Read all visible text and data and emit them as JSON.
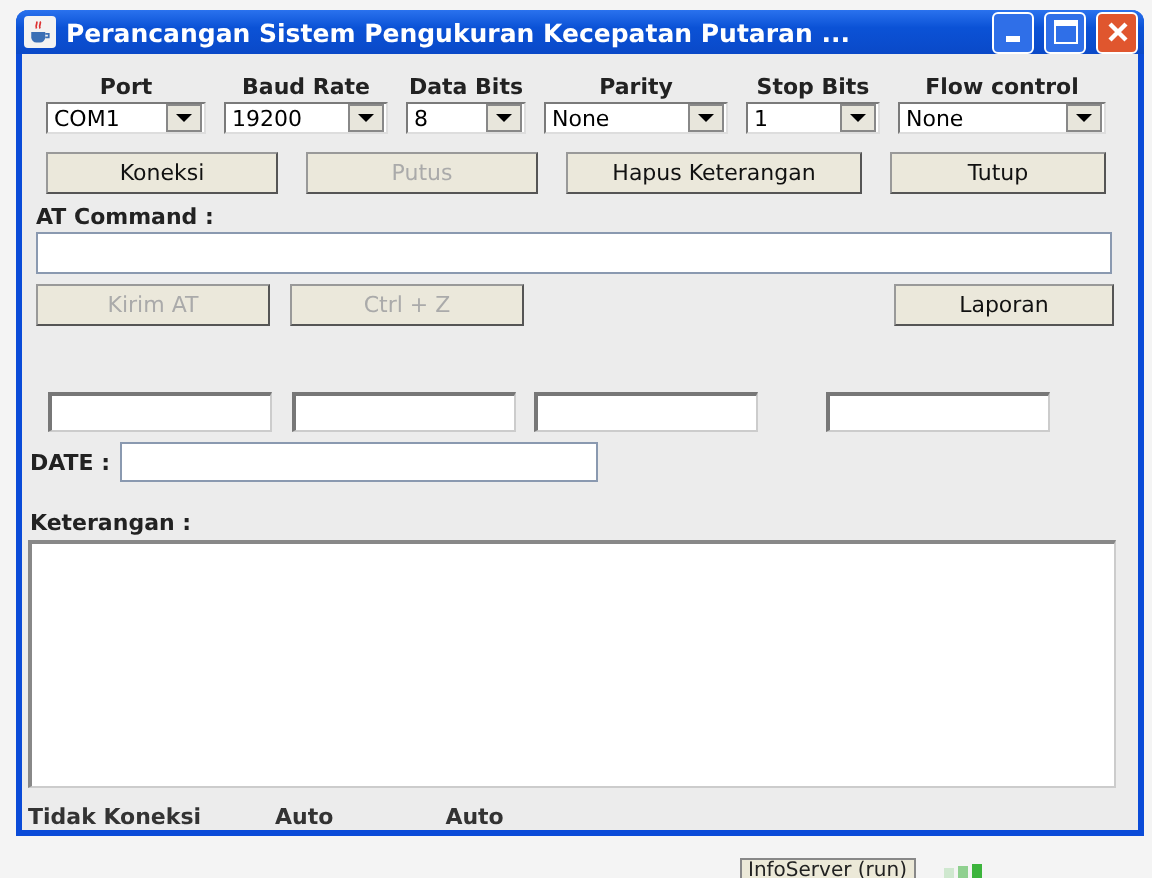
{
  "window": {
    "title": "Perancangan Sistem Pengukuran Kecepatan Putaran ..."
  },
  "settings": [
    {
      "label": "Port",
      "value": "COM1"
    },
    {
      "label": "Baud Rate",
      "value": "19200"
    },
    {
      "label": "Data Bits",
      "value": "8"
    },
    {
      "label": "Parity",
      "value": "None"
    },
    {
      "label": "Stop Bits",
      "value": "1"
    },
    {
      "label": "Flow control",
      "value": "None"
    }
  ],
  "buttons": [
    {
      "label": "Koneksi",
      "disabled": false
    },
    {
      "label": "Putus",
      "disabled": true
    },
    {
      "label": "Hapus Keterangan",
      "disabled": false
    },
    {
      "label": "Tutup",
      "disabled": false
    }
  ],
  "at_command": {
    "label": "AT Command :"
  },
  "command_buttons": [
    {
      "label": "Kirim AT",
      "disabled": true
    },
    {
      "label": "Ctrl + Z",
      "disabled": true
    },
    {
      "label": "Laporan",
      "disabled": false
    }
  ],
  "date": {
    "label": "DATE :"
  },
  "notes": {
    "label": "Keterangan :"
  },
  "status_bar": [
    "Tidak Koneksi",
    "Auto",
    "Auto"
  ],
  "taskbar": {
    "item": "InfoServer (run)"
  }
}
